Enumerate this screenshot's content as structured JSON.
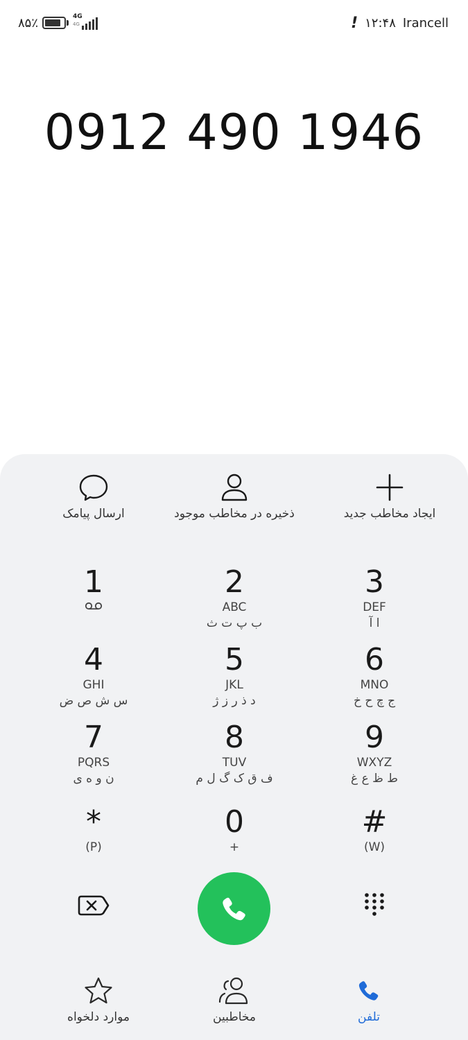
{
  "status_bar": {
    "battery_text": "۸۵٪",
    "battery_level": 0.85,
    "network_type": "4G",
    "network_sub": "4G",
    "signal_bars": 5,
    "time": "۱۲:۴۸",
    "carrier": "Irancell",
    "alert_symbol": "!"
  },
  "dialer": {
    "number": "0912 490 1946"
  },
  "actions": [
    {
      "label": "ارسال پیامک",
      "icon": "message-icon"
    },
    {
      "label": "ذخیره در مخاطب موجود",
      "icon": "person-icon"
    },
    {
      "label": "ایجاد مخاطب جدید",
      "icon": "plus-icon"
    }
  ],
  "keys": [
    {
      "digit": "1",
      "latin": "",
      "persian": "",
      "icon": "voicemail-icon"
    },
    {
      "digit": "2",
      "latin": "ABC",
      "persian": "ب پ ت ث"
    },
    {
      "digit": "3",
      "latin": "DEF",
      "persian": "ا آ"
    },
    {
      "digit": "4",
      "latin": "GHI",
      "persian": "س ش ص ض"
    },
    {
      "digit": "5",
      "latin": "JKL",
      "persian": "د ذ ر ز ژ"
    },
    {
      "digit": "6",
      "latin": "MNO",
      "persian": "ج چ ح خ"
    },
    {
      "digit": "7",
      "latin": "PQRS",
      "persian": "ن و ه ی"
    },
    {
      "digit": "8",
      "latin": "TUV",
      "persian": "ف ق ک گ ل م"
    },
    {
      "digit": "9",
      "latin": "WXYZ",
      "persian": "ط ظ ع غ"
    },
    {
      "digit": "*",
      "latin": "(P)",
      "persian": ""
    },
    {
      "digit": "0",
      "latin": "+",
      "persian": ""
    },
    {
      "digit": "#",
      "latin": "(W)",
      "persian": ""
    }
  ],
  "controls": {
    "backspace_icon": "backspace-icon",
    "call_icon": "phone-icon",
    "call_color": "#23c15b",
    "dialpad_icon": "dialpad-icon"
  },
  "bottom_nav": [
    {
      "label": "موارد دلخواه",
      "icon": "star-icon",
      "active": false
    },
    {
      "label": "مخاطبین",
      "icon": "contacts-icon",
      "active": false
    },
    {
      "label": "تلفن",
      "icon": "phone-icon",
      "active": true
    }
  ],
  "colors": {
    "accent": "#1f6bd8",
    "panel": "#f1f2f4"
  }
}
